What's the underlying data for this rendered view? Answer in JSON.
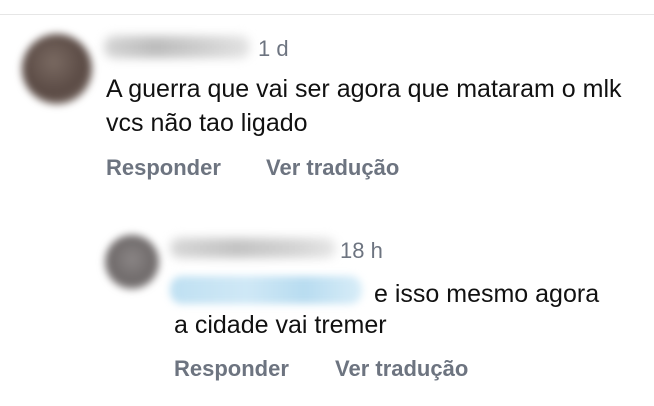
{
  "comments": [
    {
      "time": "1 d",
      "text": "A guerra que vai ser agora que mataram o mlk vcs não tao ligado",
      "reply_label": "Responder",
      "translate_label": "Ver tradução"
    }
  ],
  "reply": {
    "time": "18 h",
    "text_line1": "e isso mesmo agora",
    "text_line2": "a cidade vai tremer",
    "reply_label": "Responder",
    "translate_label": "Ver tradução"
  },
  "colors": {
    "meta_text": "#6d7480",
    "body_text": "#111111",
    "mention_blur": "#cfe8f6"
  }
}
